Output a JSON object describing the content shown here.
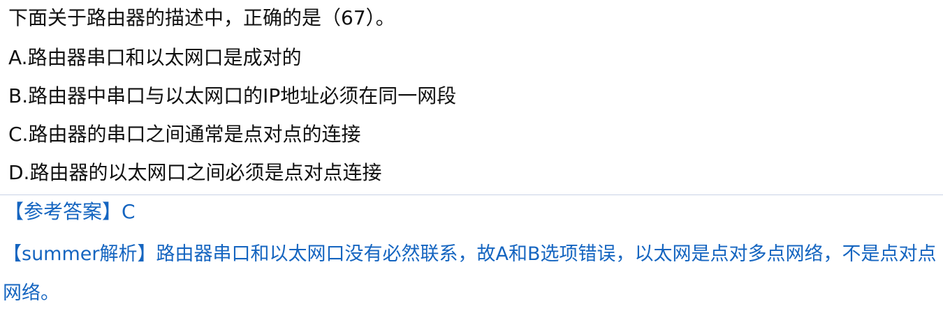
{
  "question": {
    "stem": "下面关于路由器的描述中，正确的是（67）。",
    "options": [
      "A.路由器串口和以太网口是成对的",
      "B.路由器中串口与以太网口的IP地址必须在同一网段",
      "C.路由器的串口之间通常是点对点的连接",
      "D.路由器的以太网口之间必须是点对点连接"
    ]
  },
  "answer": {
    "label": "【参考答案】",
    "value": "C"
  },
  "analysis": {
    "label": "【summer解析】",
    "text": "路由器串口和以太网口没有必然联系，故A和B选项错误，以太网是点对多点网络，不是点对点网络。"
  },
  "colors": {
    "question_text": "#111111",
    "answer_text": "#1565c0",
    "divider": "#c9d3e6"
  }
}
